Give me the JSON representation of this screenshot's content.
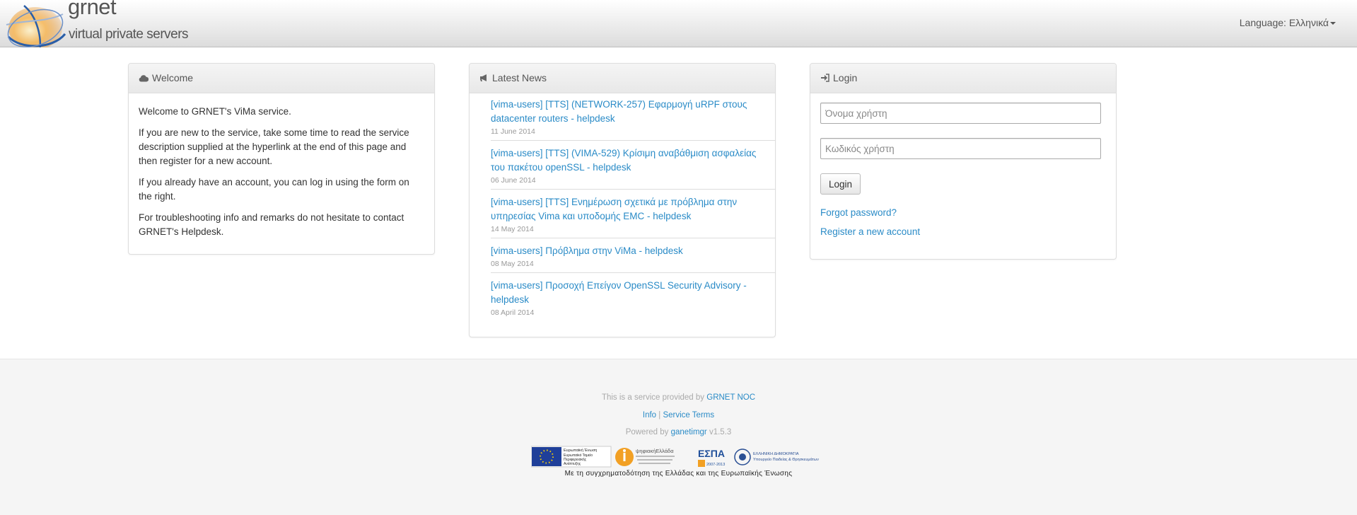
{
  "brand": {
    "name": "grnet",
    "subtitle": "virtual private servers"
  },
  "language": {
    "label": "Language:",
    "value": "Ελληνικά"
  },
  "welcome": {
    "title": "Welcome",
    "paragraphs": [
      "Welcome to GRNET's ViMa service.",
      "If you are new to the service, take some time to read the service description supplied at the hyperlink at the end of this page and then register for a new account.",
      "If you already have an account, you can log in using the form on the right.",
      "For troubleshooting info and remarks do not hesitate to contact GRNET's Helpdesk."
    ]
  },
  "news": {
    "title": "Latest News",
    "items": [
      {
        "title": "[vima-users] [TTS] (NETWORK-257) Εφαρμογή uRPF στους datacenter routers - helpdesk",
        "date": "11 June 2014"
      },
      {
        "title": "[vima-users] [TTS] (VIMA-529) Κρίσιμη αναβάθμιση ασφαλείας του πακέτου openSSL - helpdesk",
        "date": "06 June 2014"
      },
      {
        "title": "[vima-users] [TTS] Ενημέρωση σχετικά με πρόβλημα στην υπηρεσίας Vima και υποδομής EMC - helpdesk",
        "date": "14 May 2014"
      },
      {
        "title": "[vima-users] Πρόβλημα στην ViMa - helpdesk",
        "date": "08 May 2014"
      },
      {
        "title": "[vima-users] Προσοχή Επείγον OpenSSL Security Advisory - helpdesk",
        "date": "08 April 2014"
      }
    ]
  },
  "login": {
    "title": "Login",
    "username_placeholder": "Όνομα χρήστη",
    "password_placeholder": "Κωδικός χρήστη",
    "button": "Login",
    "forgot": "Forgot password?",
    "register": "Register a new account"
  },
  "footer": {
    "provided_prefix": "This is a service provided by",
    "provided_link": "GRNET NOC",
    "info": "Info",
    "separator": "|",
    "terms": "Service Terms",
    "powered_prefix": "Powered by",
    "powered_link": "ganetimgr",
    "version": "v1.5.3",
    "sponsors": {
      "eu_lines": [
        "Ευρωπαϊκή Ένωση",
        "Ευρωπαϊκό Ταμείο",
        "Περιφερειακής",
        "Ανάπτυξης"
      ],
      "digital_label": "ψηφιακήΕλλάδα",
      "espa": "ΕΣΠΑ",
      "espa_years": "2007-2013",
      "ministry_lines": [
        "ΕΛΛΗΝΙΚΗ ΔΗΜΟΚΡΑΤΙΑ",
        "Υπουργείο Παιδείας & Θρησκευμάτων"
      ]
    },
    "caption": "Με τη συγχρηματοδότηση της Ελλάδας και της Ευρωπαϊκής Ένωσης"
  },
  "colors": {
    "link": "#2a8bc7",
    "logo_orange": "#f29b2e",
    "logo_blue": "#2a5ea8"
  }
}
